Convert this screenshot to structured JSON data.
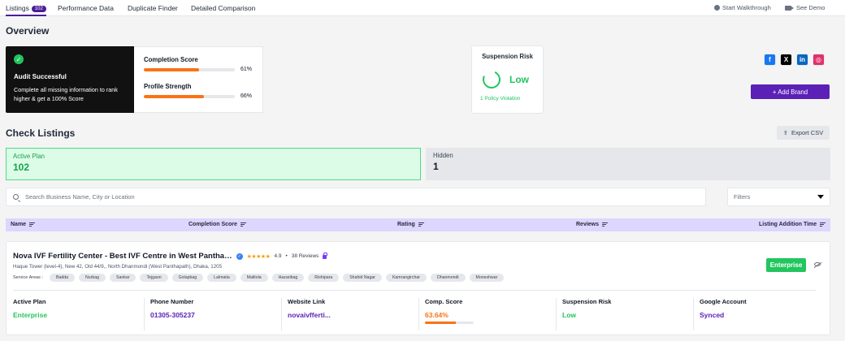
{
  "nav": {
    "tabs": [
      {
        "label": "Listings",
        "badge": "102"
      },
      {
        "label": "Performance Data"
      },
      {
        "label": "Duplicate Finder"
      },
      {
        "label": "Detailed Comparison"
      }
    ],
    "walkthrough": "Start Walkthrough",
    "demo": "See Demo"
  },
  "overview": {
    "title": "Overview",
    "audit_title": "Audit Successful",
    "audit_desc": "Complete all missing information to rank higher & get a 100% Score",
    "completion_label": "Completion Score",
    "completion_value": "61%",
    "completion_fraction": 0.61,
    "strength_label": "Profile Strength",
    "strength_value": "66%",
    "strength_fraction": 0.66,
    "suspension_title": "Suspension Risk",
    "suspension_value": "Low",
    "policy_link": "1 Policy Violation",
    "socials": [
      {
        "icon": "facebook-icon",
        "glyph": "f",
        "color": "#1877f2"
      },
      {
        "icon": "x-twitter-icon",
        "glyph": "X",
        "color": "#000000"
      },
      {
        "icon": "linkedin-icon",
        "glyph": "in",
        "color": "#0a66c2"
      },
      {
        "icon": "instagram-icon",
        "glyph": "◎",
        "color": "#e1306c"
      }
    ],
    "add_brand": "+ Add Brand"
  },
  "check": {
    "title": "Check Listings",
    "export": "Export CSV",
    "active_label": "Active Plan",
    "active_value": "102",
    "hidden_label": "Hidden",
    "hidden_value": "1",
    "search_placeholder": "Search Business Name, City or Location",
    "filters": "Filters"
  },
  "table": {
    "headers": [
      "Name",
      "Completion Score",
      "Rating",
      "Reviews",
      "Listing Addition Time"
    ]
  },
  "listing": {
    "name": "Nova IVF Fertility Center - Best IVF Centre in West Pantha…",
    "stars": "★★★★★",
    "rating": "4.9",
    "reviews": "38 Reviews",
    "address": "Haque Tower (level-4), New 42, Old 44/9,, North Dhanmondi (West Panthapath), Dhaka, 1205",
    "service_label": "Service Areas :",
    "areas": [
      "Badda",
      "Nurbag",
      "Sankar",
      "Tejgaon",
      "Golapbag",
      "Lalmatia",
      "Malitola",
      "Hazaribag",
      "Rishipara",
      "Shahid Nagar",
      "Kamrangirchar",
      "Dhanmondi",
      "Moneshwar"
    ],
    "plan_badge": "Enterprise",
    "details": [
      {
        "label": "Active Plan",
        "value": "Enterprise",
        "color": "green"
      },
      {
        "label": "Phone Number",
        "value": "01305-305237",
        "color": "purple"
      },
      {
        "label": "Website Link",
        "value": "novaivfferti...",
        "color": "purple"
      },
      {
        "label": "Comp. Score",
        "value": "63.64%",
        "color": "orange",
        "fraction": 0.6364
      },
      {
        "label": "Suspension Risk",
        "value": "Low",
        "color": "green"
      },
      {
        "label": "Google Account",
        "value": "Synced",
        "color": "purple"
      }
    ]
  }
}
